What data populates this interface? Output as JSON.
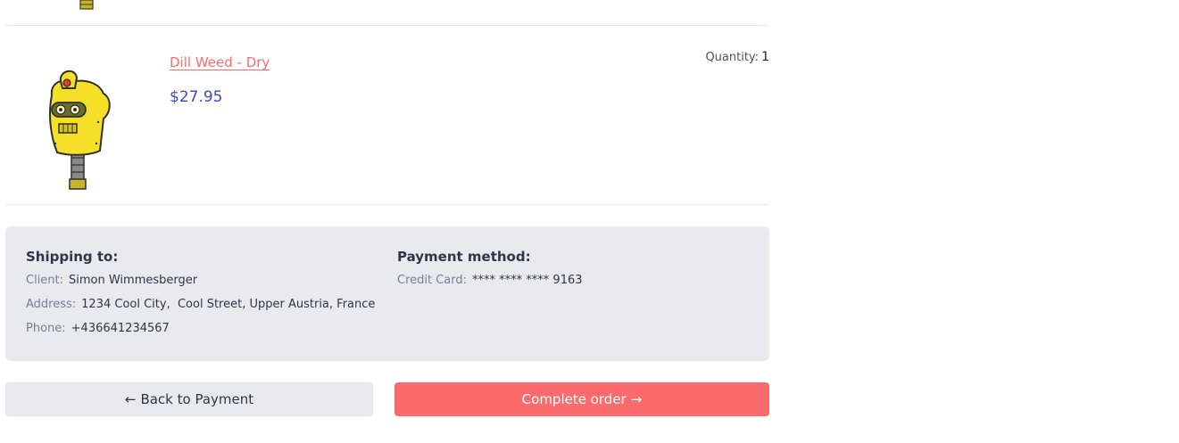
{
  "previous_item": {
    "image_icon": "robot-mascot-icon"
  },
  "cart_item": {
    "name": "Dill Weed - Dry",
    "price": "$27.95",
    "quantity_label": "Quantity:",
    "quantity_value": "1",
    "image_icon": "robot-mascot-icon"
  },
  "shipping": {
    "title": "Shipping to:",
    "client_label": "Client:",
    "client_value": "Simon Wimmesberger",
    "address_label": "Address:",
    "address_value": "1234 Cool City,  Cool Street, Upper Austria, France",
    "phone_label": "Phone:",
    "phone_value": "+436641234567"
  },
  "payment": {
    "title": "Payment method:",
    "card_label": "Credit Card:",
    "card_value": "**** **** **** 9163"
  },
  "actions": {
    "back_label": "Back to Payment",
    "back_icon": "arrow-left-icon",
    "back_arrow": "←",
    "complete_label": "Complete order",
    "complete_icon": "arrow-right-icon",
    "complete_arrow": "→"
  },
  "colors": {
    "accent": "#fc6b6b",
    "price": "#3f4cb5",
    "panel": "#e8ebee"
  }
}
